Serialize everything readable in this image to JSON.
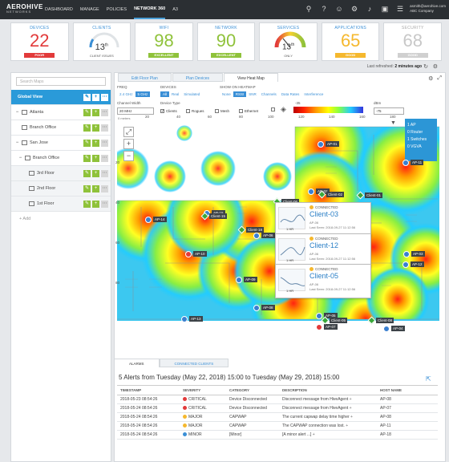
{
  "brand": {
    "name": "AEROHIVE",
    "sub": "NETWORKS"
  },
  "nav": {
    "items": [
      "DASHBOARD",
      "MANAGE",
      "POLICIES",
      "NETWORK 360",
      "A3"
    ]
  },
  "user": {
    "email": "asmith@aerohive.com",
    "company": "ABC Company"
  },
  "icons": {
    "search": "search-icon",
    "help": "help-icon",
    "user": "user-icon",
    "gear": "gear-icon",
    "bell": "bell-icon",
    "monitor": "monitor-icon",
    "menu": "menu-icon"
  },
  "cards": [
    {
      "title": "DEVICES",
      "value": "22",
      "badge": "POOR",
      "color": "#e23a3a"
    },
    {
      "title": "CLIENTS",
      "value": "13",
      "sup": "th",
      "note": "CLIENT ISSUES",
      "gauge": 0.13
    },
    {
      "title": "WIFI",
      "value": "98",
      "badge": "EXCELLENT",
      "color": "#8fc23a"
    },
    {
      "title": "NETWORK",
      "value": "90",
      "badge": "EXCELLENT",
      "color": "#8fc23a"
    },
    {
      "title": "SERVICES",
      "value": "13",
      "sup": "th",
      "note": "ONLY",
      "gauge": 0.13
    },
    {
      "title": "APPLICATIONS",
      "value": "65",
      "badge": "GOOD",
      "color": "#f5b82e"
    },
    {
      "title": "SECURITY",
      "value": "68",
      "badge": "GOOD",
      "color": "#d0d0d0"
    }
  ],
  "refresh": {
    "label": "Last refreshed:",
    "value": "2 minutes ago"
  },
  "sidebar": {
    "search": "Search Maps",
    "items": [
      {
        "label": "Global View",
        "level": 0,
        "selected": true
      },
      {
        "label": "Atlanta",
        "level": 1,
        "toggle": "−"
      },
      {
        "label": "Branch Office",
        "level": 2
      },
      {
        "label": "San Jose",
        "level": 1,
        "toggle": "−"
      },
      {
        "label": "Branch Office",
        "level": 2,
        "toggle": "−"
      },
      {
        "label": "3rd Floor",
        "level": 3
      },
      {
        "label": "2nd Floor",
        "level": 3
      },
      {
        "label": "1st Floor",
        "level": 3
      }
    ],
    "add": "+ Add"
  },
  "maptabs": [
    "Edit Floor Plan",
    "Plan Devices",
    "View Heat Map"
  ],
  "controls": {
    "freq_label": "FREQ",
    "freq": [
      "2.4 GHz",
      "5 GHz"
    ],
    "devices_label": "DEVICES",
    "devices": [
      "All",
      "Real",
      "Simulated"
    ],
    "show_label": "SHOW ON HEATMAP",
    "show": [
      "None",
      "RSSI",
      "SNR",
      "Channels",
      "Data Rates",
      "Interference"
    ],
    "chw_label": "Channel Width",
    "chw": "20 MHz",
    "dtype_label": "Device Type",
    "dtypes": [
      "Clients",
      "Rogues",
      "Mesh",
      "Ethernet"
    ],
    "scale_min": "-35",
    "scale_max": "-75",
    "dbm_label": "dBm",
    "dbm": "-75",
    "meters": "0 meters",
    "ruler": [
      "20",
      "40",
      "60",
      "80",
      "100",
      "120",
      "140",
      "160",
      "180"
    ],
    "yruler": [
      "20",
      "40",
      "60",
      "80"
    ]
  },
  "legend": [
    "1 AP",
    "0 Router",
    "1 Switches",
    "0 VGVA"
  ],
  "popups": [
    {
      "status": "CONNECTED",
      "name": "Client-03",
      "ap": "AP-06",
      "seen": "Last Seen: 2018-09-27 11:12:56",
      "hr": "1 HR"
    },
    {
      "status": "CONNECTED",
      "name": "Client-12",
      "ap": "AP-06",
      "seen": "Last Seen: 2018-09-27 11:12:56",
      "hr": "1 HR"
    },
    {
      "status": "CONNECTED",
      "name": "Client-05",
      "ap": "AP-06",
      "seen": "Last Seen: 2018-09-27 11:12:56",
      "hr": "1 HR"
    }
  ],
  "aps": [
    "AP-01",
    "AP-11",
    "AP-02",
    "AP-14",
    "AP-15",
    "AP-10",
    "AP-09",
    "AP-06",
    "AP-12",
    "AP-07",
    "AP-04",
    "AP-08",
    "AP-13",
    "AP-05",
    "AP-03"
  ],
  "clients": [
    "Client-02",
    "Client-15",
    "Client-06",
    "Client-01",
    "Client-18",
    "Client-05",
    "Client-08"
  ],
  "bottomtabs": [
    "ALARMS",
    "CONNECTED CLIENTS"
  ],
  "alerts": {
    "title": "5 Alerts from Tuesday (May 22, 2018) 15:00 to Tuesday (May 29, 2018) 15:00",
    "headers": [
      "TIMESTAMP",
      "SEVERITY",
      "CATEGORY",
      "DESCRIPTION",
      "HOST NAME"
    ],
    "rows": [
      {
        "ts": "2018-05-23 08:54:26",
        "sev": "CRITICAL",
        "color": "#e23a3a",
        "cat": "Device Disconnected",
        "desc": "Disconnect message from HiveAgent",
        "host": "AP-08"
      },
      {
        "ts": "2018-05-24 08:54:26",
        "sev": "CRITICAL",
        "color": "#e23a3a",
        "cat": "Device Disconnected",
        "desc": "Disconnect message from HiveAgent",
        "host": "AP-07"
      },
      {
        "ts": "2018-05-24 08:54:26",
        "sev": "MAJOR",
        "color": "#f5b82e",
        "cat": "CAPWAP",
        "desc": "The current capwap delay time higher",
        "host": "AP-08"
      },
      {
        "ts": "2018-05-24 08:54:26",
        "sev": "MAJOR",
        "color": "#f5b82e",
        "cat": "CAPWAP",
        "desc": "The CAPWAP connection was lost.",
        "host": "AP-11"
      },
      {
        "ts": "2018-05-24 08:54:26",
        "sev": "MINOR",
        "color": "#3a8fd6",
        "cat": "[Minor]",
        "desc": "[A minor alert ...]",
        "host": "AP-18"
      }
    ]
  }
}
